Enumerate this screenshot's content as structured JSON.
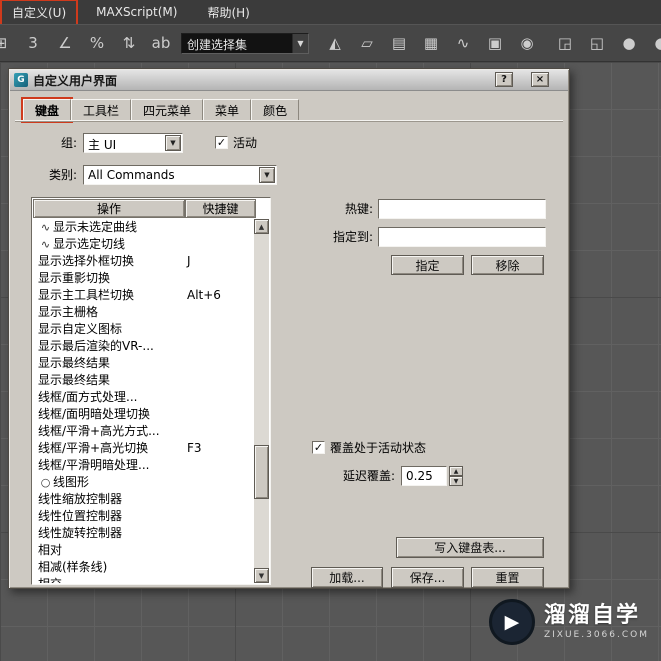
{
  "annotation_color": "#cf3a1c",
  "menu_bar": {
    "items": [
      {
        "label": "自定义(U)",
        "highlighted": true
      },
      {
        "label": "MAXScript(M)",
        "highlighted": false
      },
      {
        "label": "帮助(H)",
        "highlighted": false
      }
    ]
  },
  "toolbar": {
    "selection_set_value": "创建选择集",
    "icons": [
      {
        "name": "clipped-toolbar-icon",
        "glyph": "⊞"
      },
      {
        "name": "snap-toggle-3d-icon",
        "glyph": "3"
      },
      {
        "name": "angle-snap-icon",
        "glyph": "∠"
      },
      {
        "name": "percent-snap-icon",
        "glyph": "%"
      },
      {
        "name": "spinner-snap-icon",
        "glyph": "⇅"
      },
      {
        "name": "edit-named-selection-sets-icon",
        "glyph": "ab"
      },
      {
        "name": "mirror-icon",
        "glyph": "◭"
      },
      {
        "name": "align-icon",
        "glyph": "▱"
      },
      {
        "name": "layer-manager-icon",
        "glyph": "▤"
      },
      {
        "name": "graphite-tools-icon",
        "glyph": "▦"
      },
      {
        "name": "curve-editor-icon",
        "glyph": "∿"
      },
      {
        "name": "schematic-view-icon",
        "glyph": "▣"
      },
      {
        "name": "material-editor-icon",
        "glyph": "◉"
      },
      {
        "name": "render-setup-icon",
        "glyph": "◲"
      },
      {
        "name": "rendered-frame-icon",
        "glyph": "◱"
      },
      {
        "name": "render-production-icon",
        "glyph": "●"
      },
      {
        "name": "activeshade-icon",
        "glyph": "◐"
      }
    ]
  },
  "dialog": {
    "title": "自定义用户界面",
    "help_label": "?",
    "close_label": "×",
    "tabs": [
      {
        "label": "键盘"
      },
      {
        "label": "工具栏"
      },
      {
        "label": "四元菜单"
      },
      {
        "label": "菜单"
      },
      {
        "label": "颜色"
      }
    ],
    "group_label": "组:",
    "group_value": "主 UI",
    "active_label": "活动",
    "active_check": "✓",
    "category_label": "类别:",
    "category_value": "All Commands",
    "list": {
      "columns": [
        "操作",
        "快捷键"
      ],
      "rows": [
        {
          "glyph": "∿",
          "action": "显示未选定曲线",
          "shortcut": ""
        },
        {
          "glyph": "∿",
          "action": "显示选定切线",
          "shortcut": ""
        },
        {
          "action": "显示选择外框切换",
          "shortcut": "J"
        },
        {
          "action": "显示重影切换",
          "shortcut": ""
        },
        {
          "action": "显示主工具栏切换",
          "shortcut": "Alt+6"
        },
        {
          "action": "显示主栅格",
          "shortcut": ""
        },
        {
          "action": "显示自定义图标",
          "shortcut": ""
        },
        {
          "action": "显示最后渲染的VR-...",
          "shortcut": ""
        },
        {
          "action": "显示最终结果",
          "shortcut": ""
        },
        {
          "action": "显示最终结果",
          "shortcut": ""
        },
        {
          "action": "线框/面方式处理...",
          "shortcut": ""
        },
        {
          "action": "线框/面明暗处理切换",
          "shortcut": ""
        },
        {
          "action": "线框/平滑+高光方式...",
          "shortcut": ""
        },
        {
          "action": "线框/平滑+高光切换",
          "shortcut": "F3"
        },
        {
          "action": "线框/平滑明暗处理...",
          "shortcut": ""
        },
        {
          "glyph": "○",
          "action": "线图形",
          "shortcut": ""
        },
        {
          "action": "线性缩放控制器",
          "shortcut": ""
        },
        {
          "action": "线性位置控制器",
          "shortcut": ""
        },
        {
          "action": "线性旋转控制器",
          "shortcut": ""
        },
        {
          "action": "相对",
          "shortcut": ""
        },
        {
          "action": "相减(样条线)",
          "shortcut": ""
        },
        {
          "action": "相交",
          "shortcut": ""
        }
      ]
    },
    "hotkey_label": "热键:",
    "hotkey_value": "",
    "assigned_label": "指定到:",
    "assigned_value": "",
    "assign_button": "指定",
    "remove_button": "移除",
    "override_label": "覆盖处于活动状态",
    "override_check": "✓",
    "delay_label": "延迟覆盖:",
    "delay_value": "0.25",
    "write_button": "写入键盘表...",
    "load_button": "加载...",
    "save_button": "保存...",
    "reset_button": "重置"
  },
  "watermark": {
    "logo_glyph": "▶",
    "title": "溜溜自学",
    "subtitle": "ZIXUE.3066.COM"
  }
}
